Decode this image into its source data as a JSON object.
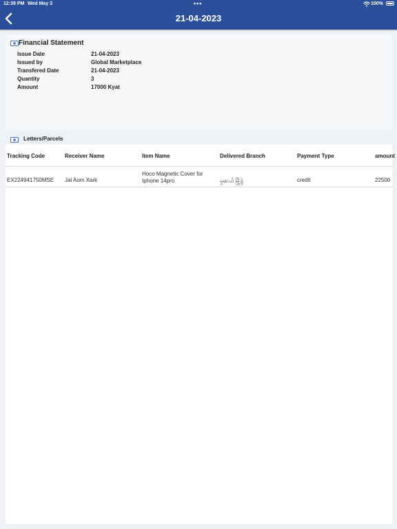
{
  "status_bar": {
    "time": "12:39 PM",
    "date": "Wed May 3",
    "dots": "•••",
    "battery": "100%"
  },
  "nav": {
    "title": "21-04-2023",
    "back_icon": "chevron-left-icon"
  },
  "statement": {
    "title": "Financial Statement",
    "icon": "money-icon",
    "fields": [
      {
        "label": "Issue Date",
        "value": "21-04-2023"
      },
      {
        "label": "Issued by",
        "value": "Global Marketplace"
      },
      {
        "label": "Transfered Date",
        "value": "21-04-2023"
      },
      {
        "label": "Quantity",
        "value": "3"
      },
      {
        "label": "Amount",
        "value": "17000 Kyat"
      }
    ]
  },
  "parcels": {
    "title": "Letters/Parcels",
    "icon": "money-icon",
    "columns": [
      "Tracking Code",
      "Receiver Name",
      "Item Name",
      "Delivered Branch",
      "Payment Type",
      "amount"
    ],
    "rows": [
      [
        "EX224941750MSE",
        "Jai Aom Xark",
        "Hoco Magnetic Cover for Iphone 14pro",
        "မူဆယ် မြို့ခွဲ",
        "credit",
        "22500"
      ]
    ]
  },
  "colors": {
    "header": "#2b4f9b",
    "background": "#eef1f5",
    "card": "#f6f7f9"
  }
}
